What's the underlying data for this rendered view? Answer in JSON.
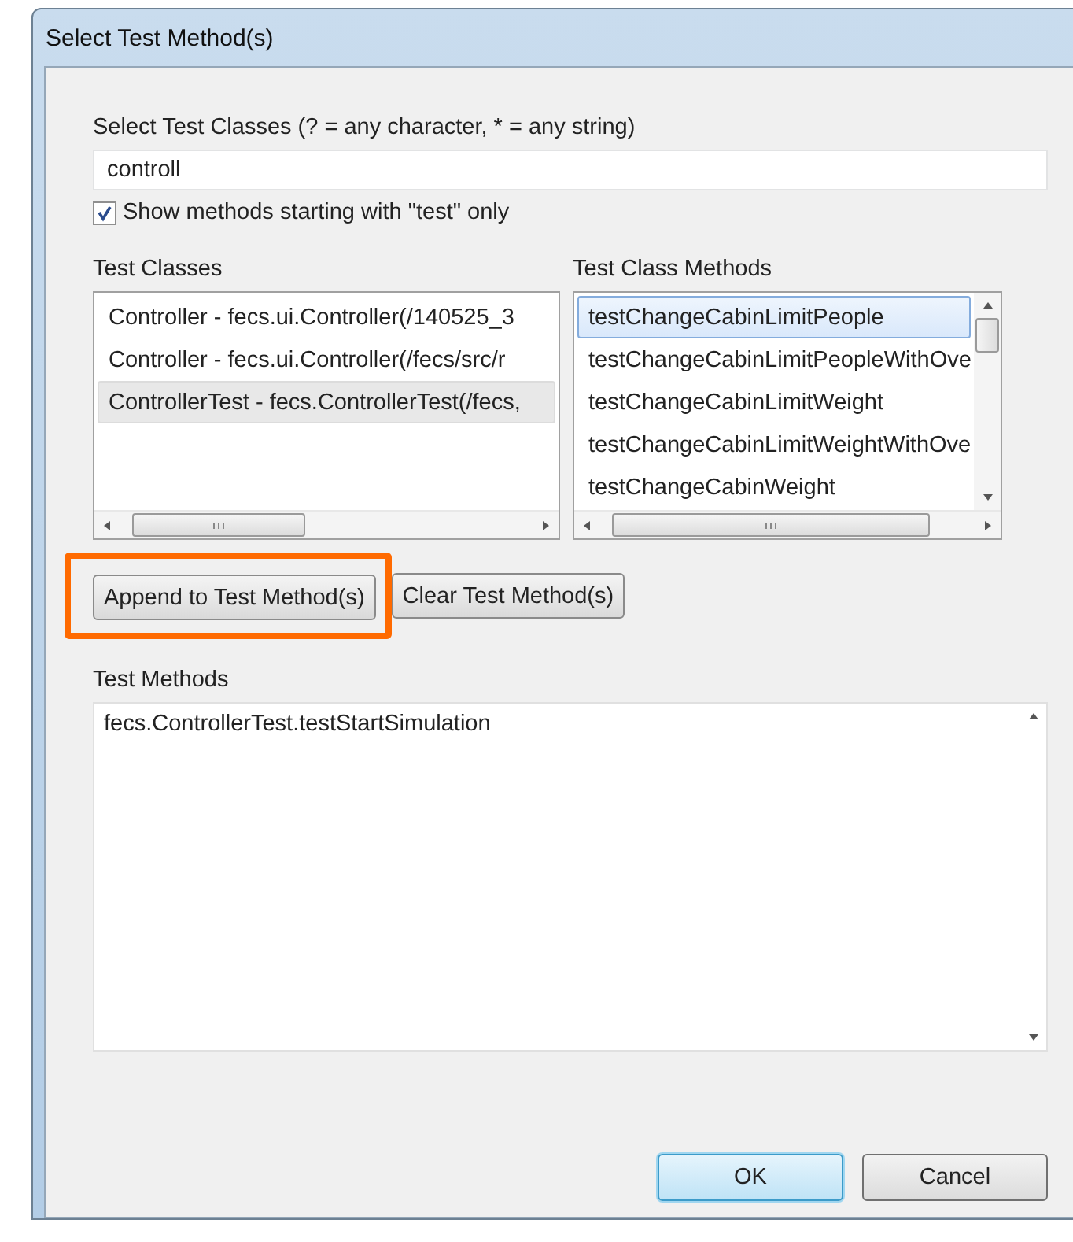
{
  "window": {
    "title": "Select Test Method(s)"
  },
  "filter": {
    "label": "Select Test Classes (? = any character, * = any string)",
    "value": "controll"
  },
  "show_test_only": {
    "label": "Show methods starting with \"test\" only",
    "checked": true
  },
  "classes": {
    "label": "Test Classes",
    "items": [
      {
        "text": "Controller - fecs.ui.Controller(/140525_3",
        "selected": false
      },
      {
        "text": "Controller - fecs.ui.Controller(/fecs/src/r",
        "selected": false
      },
      {
        "text": "ControllerTest - fecs.ControllerTest(/fecs,",
        "selected": true
      }
    ]
  },
  "methods": {
    "label": "Test Class Methods",
    "items": [
      {
        "text": "testChangeCabinLimitPeople",
        "selected": true
      },
      {
        "text": "testChangeCabinLimitPeopleWithOve",
        "selected": false
      },
      {
        "text": "testChangeCabinLimitWeight",
        "selected": false
      },
      {
        "text": "testChangeCabinLimitWeightWithOve",
        "selected": false
      },
      {
        "text": "testChangeCabinWeight",
        "selected": false
      }
    ]
  },
  "actions": [
    {
      "label": "Append to Test Method(s)",
      "highlighted": true
    },
    {
      "label": "Clear Test Method(s)",
      "highlighted": false
    }
  ],
  "test_methods": {
    "label": "Test Methods",
    "items": [
      "fecs.ControllerTest.testStartSimulation"
    ]
  },
  "buttons": [
    {
      "label": "OK",
      "default": true
    },
    {
      "label": "Cancel",
      "default": false
    }
  ]
}
